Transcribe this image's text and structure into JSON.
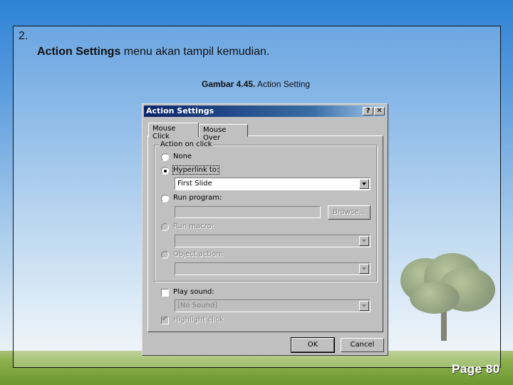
{
  "slide": {
    "number": "2.",
    "line_bold": "Action Settings",
    "line_rest": " menu akan tampil kemudian.",
    "caption_bold": "Gambar 4.45.",
    "caption_rest": " Action Setting",
    "page_label": "Page 80"
  },
  "dialog": {
    "title": "Action Settings",
    "help_button": "?",
    "close_button": "✕",
    "tabs": [
      {
        "label": "Mouse Click",
        "active": true
      },
      {
        "label": "Mouse Over",
        "active": false
      }
    ],
    "group_label": "Action on click",
    "options": [
      {
        "label": "None",
        "selected": false,
        "enabled": true
      },
      {
        "label": "Hyperlink to:",
        "selected": true,
        "enabled": true
      },
      {
        "label": "Run program:",
        "selected": false,
        "enabled": true
      },
      {
        "label": "Run macro:",
        "selected": false,
        "enabled": false
      },
      {
        "label": "Object action:",
        "selected": false,
        "enabled": false
      }
    ],
    "hyperlink_value": "First Slide",
    "run_program_value": "",
    "browse_button": "Browse...",
    "macro_value": "",
    "object_action_value": "",
    "play_sound_label": "Play sound:",
    "play_sound_checked": false,
    "sound_value": "[No Sound]",
    "highlight_click_label": "Highlight click",
    "highlight_click_checked": true,
    "ok_button": "OK",
    "cancel_button": "Cancel"
  }
}
